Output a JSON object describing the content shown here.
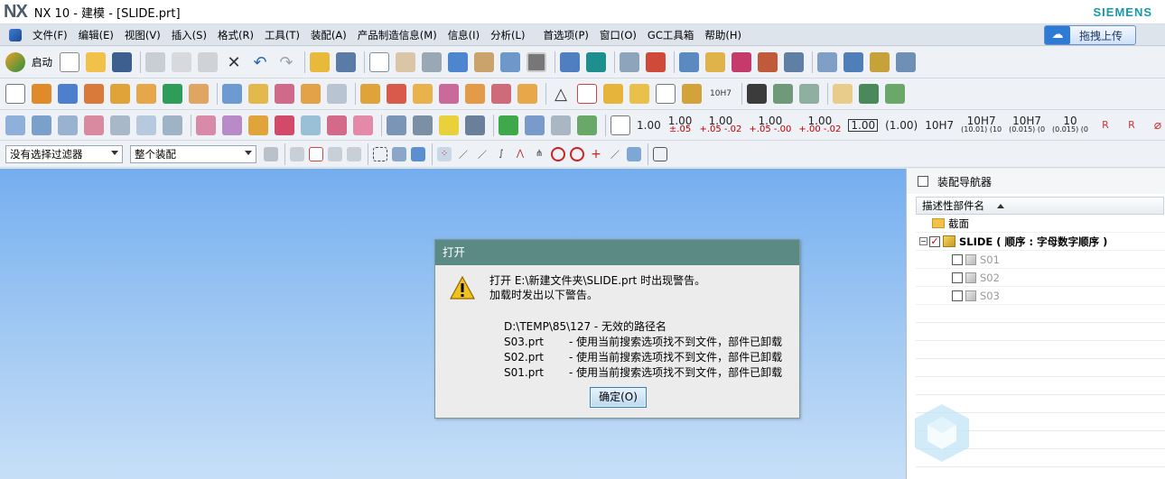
{
  "titlebar": {
    "logo": "NX",
    "title": "NX 10 - 建模 - [SLIDE.prt]",
    "brand": "SIEMENS"
  },
  "menubar": {
    "items": [
      "文件(F)",
      "编辑(E)",
      "视图(V)",
      "插入(S)",
      "格式(R)",
      "工具(T)",
      "装配(A)",
      "产品制造信息(M)",
      "信息(I)",
      "分析(L)",
      "首选项(P)",
      "窗口(O)",
      "GC工具箱",
      "帮助(H)"
    ],
    "upload_label": "拖拽上传"
  },
  "toolbar1": {
    "launch_label": "启动"
  },
  "toolbar2": {
    "tolerance_label": "10H7"
  },
  "toolbar3": {
    "quantities": [
      {
        "main": "1.00",
        "sub": ""
      },
      {
        "main": "1.00",
        "sub": "±.05"
      },
      {
        "main": "1.00",
        "sub": "+.05 -.02"
      },
      {
        "main": "1.00",
        "sub": "+.05 -.00"
      },
      {
        "main": "1.00",
        "sub": "+.00 -.02"
      },
      {
        "main": "1.00",
        "sub": ""
      },
      {
        "main": "(1.00)",
        "sub": ""
      },
      {
        "main": "10H7",
        "sub": ""
      },
      {
        "main": "10H7",
        "sub": "(10.01) (10"
      },
      {
        "main": "10H7",
        "sub": "(0.015) (0"
      },
      {
        "main": "10",
        "sub": "(0.015) (0"
      }
    ]
  },
  "toolbar4": {
    "filter_value": "没有选择过滤器",
    "scope_value": "整个装配"
  },
  "dialog": {
    "title": "打开",
    "message_line1": "打开 E:\\新建文件夹\\SLIDE.prt 时出现警告。",
    "message_line2": "加载时发出以下警告。",
    "path_line": "D:\\TEMP\\85\\127 - 无效的路径名",
    "warnings": [
      {
        "file": "S03.prt",
        "text": "- 使用当前搜索选项找不到文件，部件已卸载"
      },
      {
        "file": "S02.prt",
        "text": "- 使用当前搜索选项找不到文件，部件已卸载"
      },
      {
        "file": "S01.prt",
        "text": "- 使用当前搜索选项找不到文件，部件已卸载"
      }
    ],
    "ok_label": "确定(O)"
  },
  "navigator": {
    "title": "装配导航器",
    "column_header": "描述性部件名",
    "section_label": "截面",
    "root_label": "SLIDE ( 顺序 : 字母数字顺序 )",
    "children": [
      "S01",
      "S02",
      "S03"
    ]
  },
  "colors": {
    "dialog_title": "#5b8a85",
    "viewport_top": "#74aef0",
    "brand": "#179aa8"
  }
}
